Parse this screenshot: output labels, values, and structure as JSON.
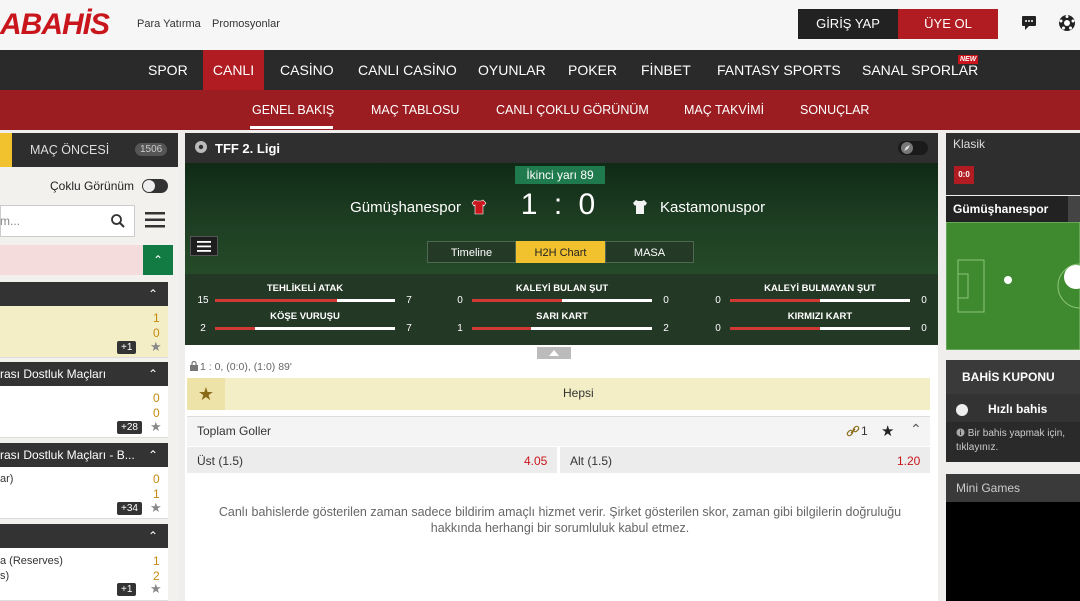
{
  "header": {
    "logo": "ABAHİS",
    "links": [
      "Para Yatırma",
      "Promosyonlar"
    ],
    "login": "GİRİŞ YAP",
    "signup": "ÜYE OL"
  },
  "mainnav": [
    "SPOR",
    "CANLI",
    "CASİNO",
    "CANLI CASİNO",
    "OYUNLAR",
    "POKER",
    "FİNBET",
    "FANTASY SPORTS",
    "SANAL SPORLAR"
  ],
  "new_badge": "NEW",
  "subnav": [
    "GENEL BAKIŞ",
    "MAÇ TABLOSU",
    "CANLI ÇOKLU GÖRÜNÜM",
    "MAÇ TAKVİMİ",
    "SONUÇLAR"
  ],
  "left": {
    "tab": "MAÇ ÖNCESİ",
    "count": "1506",
    "multi_view": "Çoklu Görünüm",
    "search_placeholder": "m...",
    "groups": [
      {
        "title": "",
        "rows": [
          {
            "home": "",
            "away": "",
            "s1": "1",
            "s2": "0",
            "count": "+1"
          }
        ]
      },
      {
        "title": "rası Dostluk Maçları",
        "rows": [
          {
            "home": "",
            "away": "",
            "s1": "0",
            "s2": "0",
            "count": "+28"
          }
        ]
      },
      {
        "title": "rası Dostluk Maçları - B...",
        "rows": [
          {
            "home": "ar)",
            "away": "",
            "s1": "0",
            "s2": "1",
            "count": "+34"
          }
        ]
      },
      {
        "title": "",
        "rows": [
          {
            "home": "a (Reserves)",
            "away": "s)",
            "s1": "1",
            "s2": "2",
            "count": "+1"
          }
        ]
      }
    ]
  },
  "match": {
    "league": "TFF 2. Ligi",
    "period": "İkinci yarı 89",
    "home": "Gümüşhanespor",
    "away": "Kastamonuspor",
    "score_home": "1",
    "score_sep": ":",
    "score_away": "0",
    "tabs": [
      "Timeline",
      "H2H Chart",
      "MASA"
    ],
    "stats": [
      {
        "label": "TEHLİKELİ ATAK",
        "home": "15",
        "away": "7",
        "share": 0.68
      },
      {
        "label": "KALEYİ BULAN ŞUT",
        "home": "0",
        "away": "0",
        "share": 0.5
      },
      {
        "label": "KALEYİ BULMAYAN ŞUT",
        "home": "0",
        "away": "0",
        "share": 0.5
      },
      {
        "label": "KÖŞE VURUŞU",
        "home": "2",
        "away": "7",
        "share": 0.22
      },
      {
        "label": "SARI KART",
        "home": "1",
        "away": "2",
        "share": 0.33
      },
      {
        "label": "KIRMIZI KART",
        "home": "0",
        "away": "0",
        "share": 0.5
      }
    ],
    "score_info": "1 : 0, (0:0), (1:0) 89'",
    "filter": "Hepsi",
    "market": "Toplam Goller",
    "market_count": "1",
    "odds": [
      {
        "label": "Üst (1.5)",
        "value": "4.05"
      },
      {
        "label": "Alt (1.5)",
        "value": "1.20"
      }
    ],
    "disclaimer": "Canlı bahislerde gösterilen zaman sadece bildirim amaçlı hizmet verir. Şirket gösterilen skor, zaman gibi bilgilerin doğruluğu hakkında herhangi bir sorumluluk kabul etmez."
  },
  "right": {
    "view": "Klasik",
    "team": "Gümüşhanespor",
    "coupon": "BAHİS KUPONU",
    "quick": "Hızlı bahis",
    "info": "Bir bahis yapmak için, tıklayınız.",
    "mini_games": "Mini Games"
  },
  "colors": {
    "brand": "#b01c22",
    "dark": "#2a2a2a",
    "accent": "#f2c12e",
    "odd": "#c8161c"
  }
}
